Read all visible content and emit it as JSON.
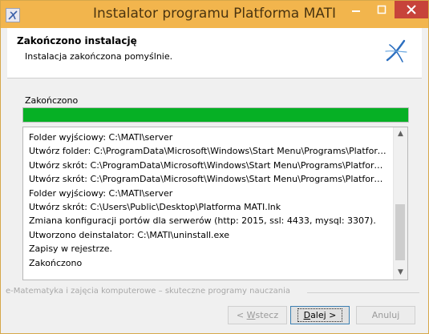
{
  "window": {
    "title": "Instalator programu Platforma MATI",
    "colors": {
      "titlebar": "#f2b54d",
      "close": "#c7433a",
      "progress": "#06b025"
    }
  },
  "header": {
    "title": "Zakończono instalację",
    "subtitle": "Instalacja zakończona pomyślnie.",
    "logo_icon": "mati-logo-icon"
  },
  "status": {
    "label": "Zakończono",
    "progress": 1.0
  },
  "log": {
    "lines": [
      "Folder wyjściowy: C:\\MATI\\server",
      "Utwórz folder: C:\\ProgramData\\Microsoft\\Windows\\Start Menu\\Programs\\Platforma ...",
      "Utwórz skrót: C:\\ProgramData\\Microsoft\\Windows\\Start Menu\\Programs\\Platforma M...",
      "Utwórz skrót: C:\\ProgramData\\Microsoft\\Windows\\Start Menu\\Programs\\Platforma M...",
      "Folder wyjściowy: C:\\MATI\\server",
      "Utwórz skrót: C:\\Users\\Public\\Desktop\\Platforma MATI.lnk",
      "Zmiana konfiguracji portów dla serwerów (http: 2015, ssl: 4433, mysql: 3307).",
      "Utworzono deinstalator: C:\\MATI\\uninstall.exe",
      "Zapisy w rejestrze.",
      "Zakończono"
    ]
  },
  "footer": {
    "text": "e-Matematyka i zajęcia komputerowe – skuteczne programy nauczania"
  },
  "buttons": {
    "back": {
      "prefix": "< ",
      "accel": "W",
      "rest": "stecz"
    },
    "next": {
      "accel": "D",
      "rest": "alej >"
    },
    "cancel": "Anuluj"
  }
}
